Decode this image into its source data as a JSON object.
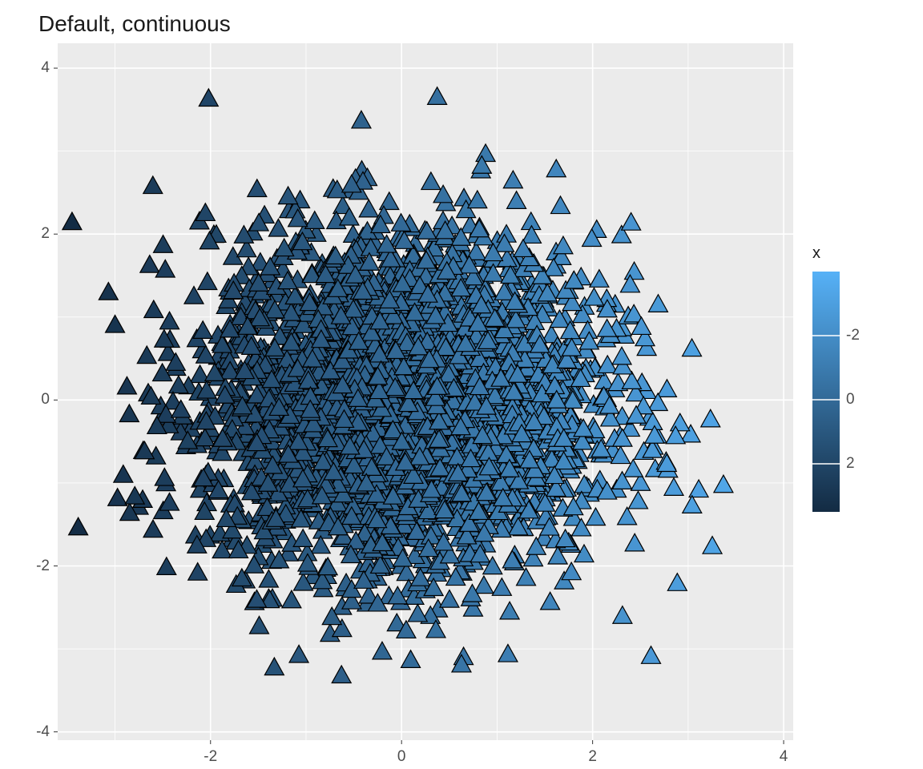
{
  "chart_data": {
    "type": "scatter",
    "title": "Default, continuous",
    "xlabel": "",
    "ylabel": "",
    "xlim": [
      -3.6,
      4.1
    ],
    "ylim": [
      -4.1,
      4.3
    ],
    "x_ticks": [
      -2,
      0,
      2,
      4
    ],
    "y_ticks": [
      -4,
      -2,
      0,
      2,
      4
    ],
    "marker": "triangle",
    "marker_size": 24,
    "marker_stroke": "#000000",
    "color_by": "x",
    "color_scale": {
      "type": "continuous",
      "low": "#132B43",
      "high": "#56B1F7",
      "domain": [
        -3.5,
        4.0
      ],
      "legend_ticks": [
        -2,
        0,
        2
      ],
      "legend_title": "x"
    },
    "n_points": 3200,
    "distribution": "bivariate normal, approx N(0,1) on each axis, independent",
    "note": "dense scatter; color maps linearly to x coordinate"
  },
  "title": "Default, continuous",
  "axis": {
    "x_ticklabels": [
      "-2",
      "0",
      "2",
      "4"
    ],
    "y_ticklabels": [
      "-4",
      "-2",
      "0",
      "2",
      "4"
    ]
  },
  "legend": {
    "title": "x",
    "ticks": [
      "2",
      "0",
      "-2"
    ]
  }
}
